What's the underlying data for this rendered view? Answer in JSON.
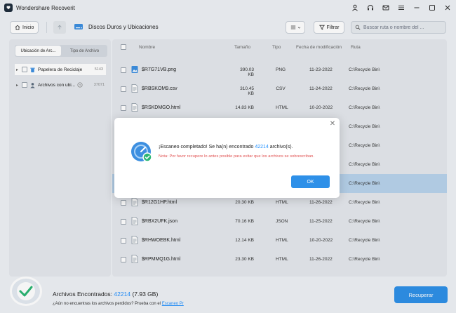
{
  "window": {
    "title": "Wondershare Recoverit",
    "controls": [
      "user-icon",
      "headset-icon",
      "mail-icon",
      "menu-icon",
      "minimize-icon",
      "maximize-icon",
      "close-icon"
    ]
  },
  "toolbar": {
    "home_label": "Inicio",
    "location_label": "Discos Duros y Ubicaciones",
    "filter_label": "Filtrar",
    "search_placeholder": "Buscar ruta o nombre del ..."
  },
  "sidebar": {
    "tabs": [
      {
        "label": "Ubicación de Arc...",
        "active": true
      },
      {
        "label": "Tipo de Archivo",
        "active": false
      }
    ],
    "items": [
      {
        "label": "Papelera de Reciclaje",
        "count": "5143",
        "icon": "recycle-bin-icon",
        "selected": true
      },
      {
        "label": "Archivos con ubi...",
        "count": "37071",
        "icon": "user-files-icon",
        "selected": false
      }
    ]
  },
  "table": {
    "headers": {
      "name": "Nombre",
      "size": "Tamaño",
      "type": "Tipo",
      "date": "Fecha de modificación",
      "path": "Ruta"
    },
    "rows": [
      {
        "name": "$R7G71VB.png",
        "size": "390.03 KB",
        "type": "PNG",
        "date": "11-23-2022",
        "path": "C:\\Recycle Bin\\",
        "icon": "image-file-icon",
        "selected": false
      },
      {
        "name": "$RBSKOM9.csv",
        "size": "310.45 KB",
        "type": "CSV",
        "date": "11-24-2022",
        "path": "C:\\Recycle Bin\\",
        "icon": "document-file-icon",
        "selected": false
      },
      {
        "name": "$RSKDMGO.html",
        "size": "14.83 KB",
        "type": "HTML",
        "date": "10-20-2022",
        "path": "C:\\Recycle Bin\\",
        "icon": "document-file-icon",
        "selected": false
      },
      {
        "name": "",
        "size": "",
        "type": "",
        "date": "",
        "path": "C:\\Recycle Bin\\",
        "icon": "document-file-icon",
        "selected": false
      },
      {
        "name": "",
        "size": "",
        "type": "",
        "date": "",
        "path": "C:\\Recycle Bin\\",
        "icon": "document-file-icon",
        "selected": false
      },
      {
        "name": "",
        "size": "",
        "type": "",
        "date": "",
        "path": "C:\\Recycle Bin\\",
        "icon": "document-file-icon",
        "selected": false
      },
      {
        "name": "",
        "size": "",
        "type": "",
        "date": "",
        "path": "C:\\Recycle Bin\\",
        "icon": "document-file-icon",
        "selected": true
      },
      {
        "name": "$R12G1HP.html",
        "size": "20.30 KB",
        "type": "HTML",
        "date": "11-26-2022",
        "path": "C:\\Recycle Bin\\",
        "icon": "document-file-icon",
        "selected": false
      },
      {
        "name": "$RBX2UFK.json",
        "size": "70.16 KB",
        "type": "JSON",
        "date": "11-25-2022",
        "path": "C:\\Recycle Bin\\",
        "icon": "document-file-icon",
        "selected": false
      },
      {
        "name": "$RHWOEBK.html",
        "size": "12.14 KB",
        "type": "HTML",
        "date": "10-20-2022",
        "path": "C:\\Recycle Bin\\",
        "icon": "document-file-icon",
        "selected": false
      },
      {
        "name": "$RPMMQ1G.html",
        "size": "23.30 KB",
        "type": "HTML",
        "date": "11-26-2022",
        "path": "C:\\Recycle Bin\\",
        "icon": "document-file-icon",
        "selected": false
      }
    ]
  },
  "footer": {
    "found_label": "Archivos Encontrados:",
    "found_count": "42214",
    "found_size": "(7.93 GB)",
    "hint_text": "¿Aún no encuentras los archivos perdidos? Prueba con el",
    "hint_link": "Escaneo Pr",
    "recover_label": "Recuperar"
  },
  "modal": {
    "title_prefix": "¡Escaneo completado! Se ha(n) encontrado",
    "count": "42214",
    "title_suffix": "archivo(s).",
    "note": "Nota: Por favor recupere lo antes posible para evitar que los archivos se sobrescriban.",
    "ok_label": "OK"
  },
  "colors": {
    "accent": "#2e90e8",
    "link": "#1f8fff",
    "warning": "#e05252",
    "selected_row": "#b8d3ec",
    "success": "#2bb673"
  }
}
